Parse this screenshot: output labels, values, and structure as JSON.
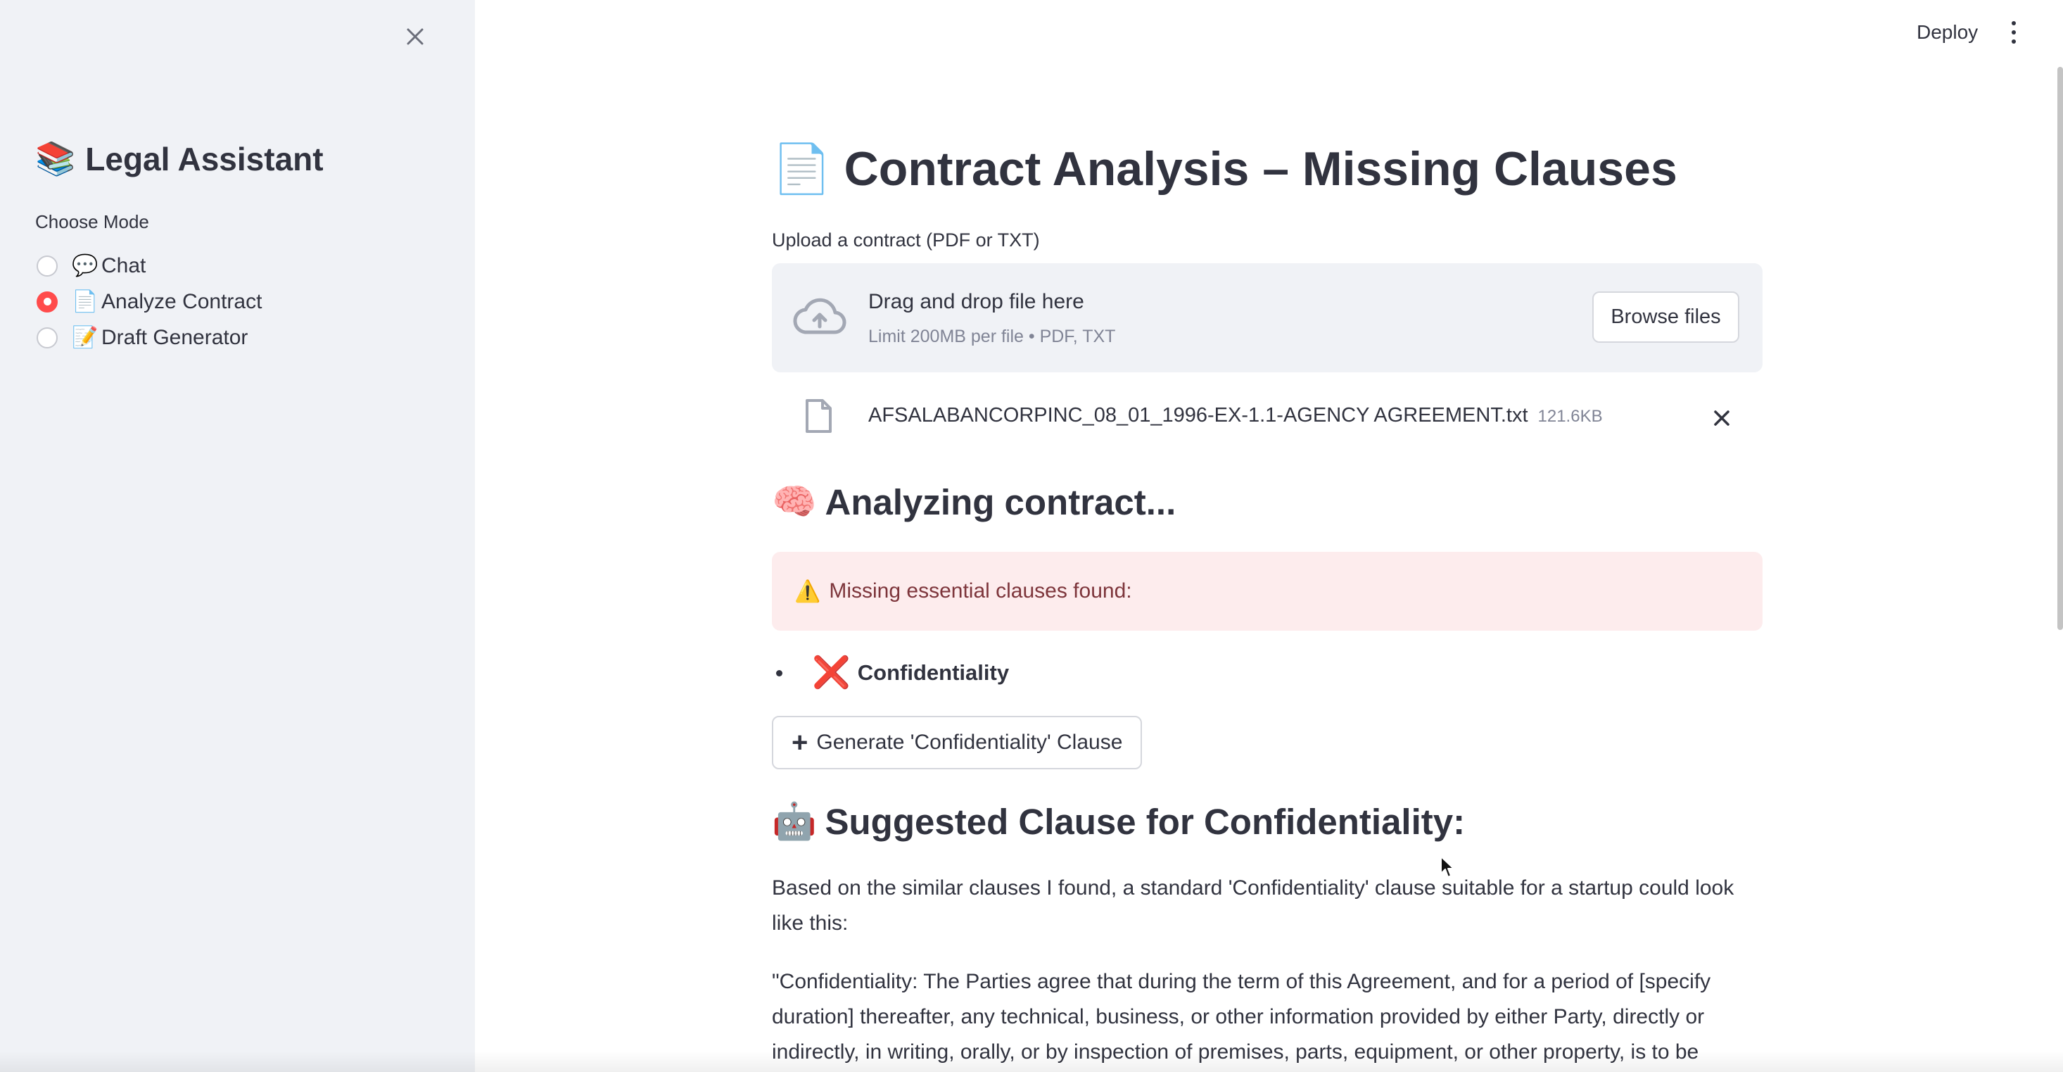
{
  "sidebar": {
    "title_emoji": "📚",
    "title": "Legal Assistant",
    "mode_label": "Choose Mode",
    "modes": [
      {
        "emoji": "💬",
        "label": "Chat",
        "selected": false
      },
      {
        "emoji": "📄",
        "label": "Analyze Contract",
        "selected": true
      },
      {
        "emoji": "📝",
        "label": "Draft Generator",
        "selected": false
      }
    ]
  },
  "header": {
    "deploy_label": "Deploy"
  },
  "main": {
    "title_emoji": "📄",
    "title": "Contract Analysis – Missing Clauses",
    "upload_label": "Upload a contract (PDF or TXT)",
    "dropzone": {
      "title": "Drag and drop file here",
      "subtitle": "Limit 200MB per file • PDF, TXT",
      "browse_label": "Browse files"
    },
    "file": {
      "name": "AFSALABANCORPINC_08_01_1996-EX-1.1-AGENCY AGREEMENT.txt",
      "size": "121.6KB"
    },
    "analyzing": {
      "emoji": "🧠",
      "title": "Analyzing contract..."
    },
    "alert": {
      "emoji": "⚠️",
      "text": "Missing essential clauses found:"
    },
    "missing": [
      {
        "mark": "❌",
        "label": "Confidentiality"
      }
    ],
    "generate_button": {
      "icon": "+",
      "label": "Generate 'Confidentiality' Clause"
    },
    "suggested": {
      "emoji": "🤖",
      "title": "Suggested Clause for Confidentiality:",
      "intro": "Based on the similar clauses I found, a standard 'Confidentiality' clause suitable for a startup could look like this:",
      "clause": "\"Confidentiality: The Parties agree that during the term of this Agreement, and for a period of [specify duration] thereafter, any technical, business, or other information provided by either Party, directly or indirectly, in writing, orally, or by inspection of premises, parts, equipment, or other property, is to be"
    }
  },
  "colors": {
    "accent": "#ff4b4b",
    "sidebar_bg": "#f0f2f6",
    "alert_bg": "#fdeced",
    "alert_text": "#7d353b",
    "text": "#31333f"
  }
}
